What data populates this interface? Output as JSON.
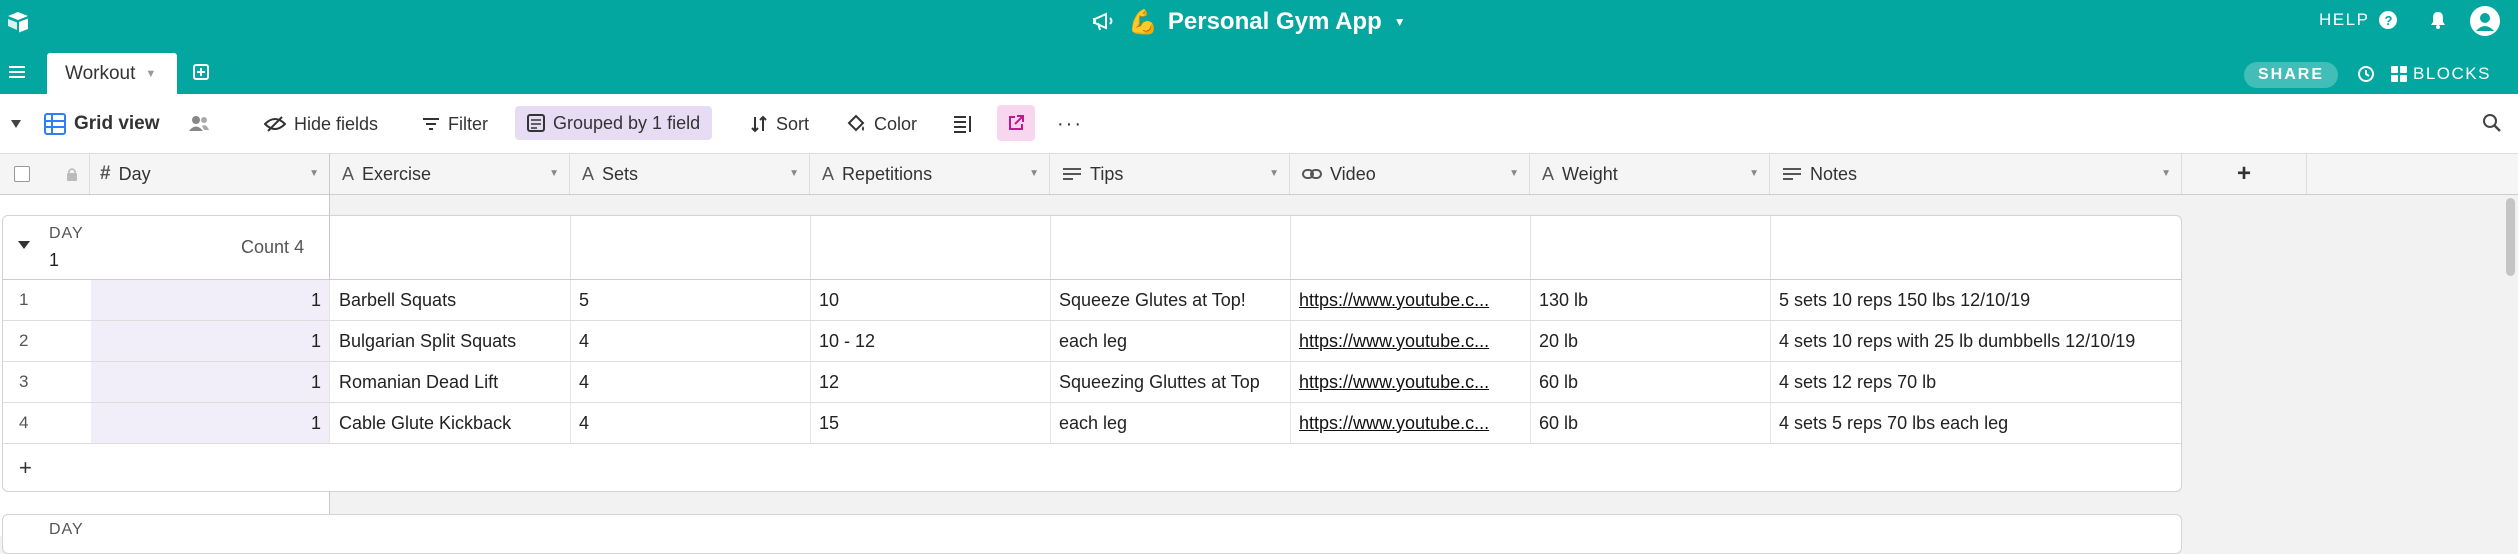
{
  "app": {
    "title": "Personal Gym App",
    "emoji": "💪",
    "help_label": "HELP",
    "help_icon_text": "?"
  },
  "tabs": [
    {
      "label": "Workout"
    }
  ],
  "header_right": {
    "share_label": "SHARE",
    "blocks_label": "BLOCKS"
  },
  "toolbar": {
    "view_name": "Grid view",
    "hide_fields": "Hide fields",
    "filter": "Filter",
    "group": "Grouped by 1 field",
    "sort": "Sort",
    "color": "Color",
    "more": "···"
  },
  "columns": [
    {
      "label": "Day",
      "type": "number"
    },
    {
      "label": "Exercise",
      "type": "text"
    },
    {
      "label": "Sets",
      "type": "text"
    },
    {
      "label": "Repetitions",
      "type": "text"
    },
    {
      "label": "Tips",
      "type": "text"
    },
    {
      "label": "Video",
      "type": "url"
    },
    {
      "label": "Weight",
      "type": "text"
    },
    {
      "label": "Notes",
      "type": "long-text"
    }
  ],
  "add_column_label": "+",
  "groups": [
    {
      "label": "DAY",
      "value": "1",
      "count_label": "Count",
      "count": "4",
      "rows": [
        {
          "num": "1",
          "day": "1",
          "exercise": "Barbell Squats",
          "sets": "5",
          "reps": "10",
          "tips": "Squeeze Glutes at Top!",
          "video": "https://www.youtube.c...",
          "weight": "130 lb",
          "notes": "5 sets 10 reps 150 lbs 12/10/19"
        },
        {
          "num": "2",
          "day": "1",
          "exercise": "Bulgarian Split Squats",
          "sets": "4",
          "reps": "10 - 12",
          "tips": "each leg",
          "video": "https://www.youtube.c...",
          "weight": "20 lb",
          "notes": "4 sets 10 reps with 25 lb dumbbells 12/10/19"
        },
        {
          "num": "3",
          "day": "1",
          "exercise": "Romanian Dead Lift",
          "sets": "4",
          "reps": "12",
          "tips": "Squeezing Gluttes at Top",
          "video": "https://www.youtube.c...",
          "weight": "60 lb",
          "notes": "4 sets 12 reps 70 lb"
        },
        {
          "num": "4",
          "day": "1",
          "exercise": "Cable Glute Kickback",
          "sets": "4",
          "reps": "15",
          "tips": "each leg",
          "video": "https://www.youtube.c...",
          "weight": "60 lb",
          "notes": "4 sets 5 reps 70 lbs each leg"
        }
      ],
      "add_row_label": "+"
    },
    {
      "label": "DAY"
    }
  ],
  "colors": {
    "brand": "#04a79f",
    "group_pill": "#e6ddf5",
    "day_cell": "#f1eefa",
    "share_view": "#f7d6ee"
  }
}
